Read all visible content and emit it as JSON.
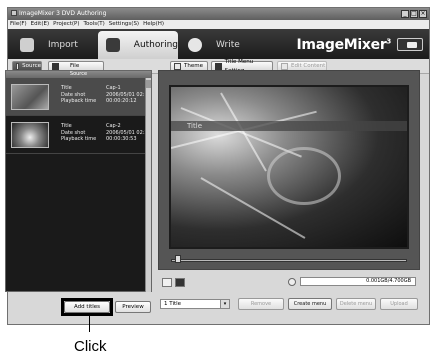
{
  "window": {
    "title": "ImageMixer 3 DVD Authoring",
    "controls": [
      "_",
      "□",
      "×"
    ]
  },
  "menu": [
    "File(F)",
    "Edit(E)",
    "Project(P)",
    "Tools(T)",
    "Settings(S)",
    "Help(H)"
  ],
  "modes": [
    {
      "label": "Import",
      "icon": "import-icon"
    },
    {
      "label": "Authoring",
      "icon": "authoring-icon"
    },
    {
      "label": "Write",
      "icon": "write-icon"
    }
  ],
  "brand": {
    "name": "ImageMixer",
    "version": "3"
  },
  "toolbar": {
    "source_label": "Source",
    "file_label": "File",
    "theme_label": "Theme",
    "title_menu_label": "Title Menu Setting",
    "edit_content_label": "Edit Content"
  },
  "source_panel": {
    "header": "Source",
    "clips": [
      {
        "title_label": "Title",
        "title": "Cap-1",
        "date_label": "Date shot",
        "date": "2006/05/01 02:12",
        "time_label": "Playback time",
        "time": "00:00:20:12"
      },
      {
        "title_label": "Title",
        "title": "Cap-2",
        "date_label": "Date shot",
        "date": "2006/05/01 02:27",
        "time_label": "Playback time",
        "time": "00:00:30:53"
      }
    ],
    "add_titles": "Add titles",
    "preview": "Preview"
  },
  "preview": {
    "title_text": "Title"
  },
  "bottom": {
    "capacity": "0.001GB/4.700GB",
    "title_select": "1 Title",
    "buttons": [
      "Remove",
      "Create menu",
      "Delete menu",
      "Upload"
    ]
  },
  "annotation": {
    "label": "Click"
  }
}
